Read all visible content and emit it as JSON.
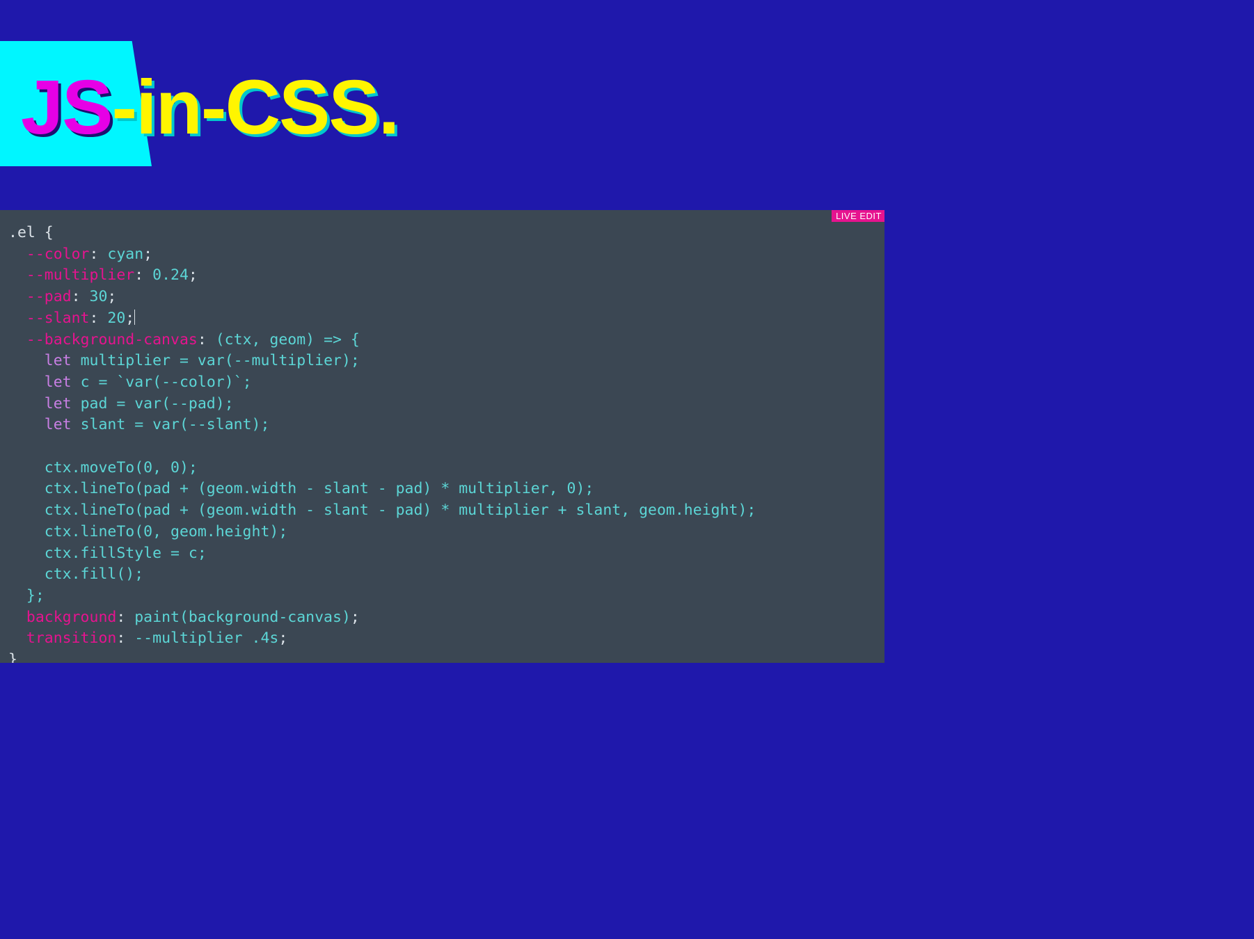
{
  "hero": {
    "part1": "JS",
    "part2": "-in-CSS."
  },
  "live_edit_label": "LIVE EDIT",
  "code": {
    "selector": ".el",
    "open": " {",
    "close": "}",
    "color_prop": "--color",
    "color_val": "cyan",
    "mult_prop": "--multiplier",
    "mult_val": "0.24",
    "pad_prop": "--pad",
    "pad_val": "30",
    "slant_prop": "--slant",
    "slant_val": "20",
    "bgcanvas_prop": "--background-canvas",
    "bgcanvas_sig": "(ctx, geom) => {",
    "let_kw": "let",
    "l1a": " multiplier = ",
    "l1b": "var",
    "l1c": "(",
    "l1d": "--multiplier",
    "l1e": ");",
    "l2a": " c = `",
    "l2b": "var",
    "l2c": "(",
    "l2d": "--color",
    "l2e": ")",
    "l2f": "`;",
    "l3a": " pad = ",
    "l3b": "var",
    "l3c": "(",
    "l3d": "--pad",
    "l3e": ");",
    "l4a": " slant = ",
    "l4b": "var",
    "l4c": "(",
    "l4d": "--slant",
    "l4e": ");",
    "body1": "ctx.moveTo(0, 0);",
    "body2": "ctx.lineTo(pad + (geom.width - slant - pad) * multiplier, 0);",
    "body3": "ctx.lineTo(pad + (geom.width - slant - pad) * multiplier + slant, geom.height);",
    "body4": "ctx.lineTo(0, geom.height);",
    "body5": "ctx.fillStyle = c;",
    "body6": "ctx.fill();",
    "bgcanvas_close": "};",
    "bg_prop": "background",
    "bg_val": "paint(background-canvas)",
    "trans_prop": "transition",
    "trans_val": "--multiplier .4s",
    "colon": ": ",
    "semi": ";"
  }
}
